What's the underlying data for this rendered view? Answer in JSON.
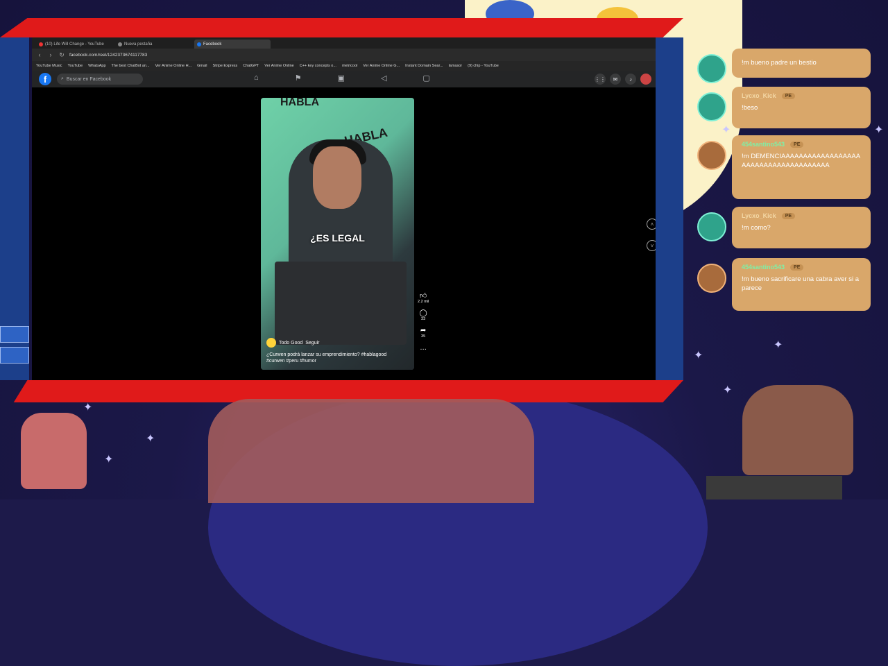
{
  "browser": {
    "tabs": [
      {
        "label": "(10) Life Will Change - YouTube",
        "active": false
      },
      {
        "label": "Nueva pestaña",
        "active": false
      },
      {
        "label": "Facebook",
        "active": true
      }
    ],
    "url": "facebook.com/reel/1242373674117783",
    "bookmarks": [
      "YouTube Music",
      "YouTube",
      "WhatsApp",
      "The best ChatBot an...",
      "Ver Anime Online H...",
      "Gmail",
      "Stripe Express",
      "ChatGPT",
      "Ver Anime Online",
      "C++ key concepts o...",
      "metricool",
      "Ver Anime Online G...",
      "Instant Domain Sear...",
      "lamasor",
      "(9) chip - YouTube"
    ]
  },
  "facebook": {
    "search_placeholder": "Buscar en Facebook",
    "reel": {
      "overlay_caption": "¿ES LEGAL",
      "author": "Todo Good",
      "follow": "Seguir",
      "description": "¿Curwen podrá lanzar su emprendimiento? #hablagood #curwen #peru #humor",
      "likes": "2.2 mil",
      "comments": "33",
      "shares": "35"
    }
  },
  "chat": {
    "messages": [
      {
        "user": "",
        "badge": "",
        "text": "!m bueno padre un bestio"
      },
      {
        "user": "Lycxo_Kick",
        "badge": "PE",
        "text": "!beso"
      },
      {
        "user": "454santino543",
        "badge": "PE",
        "text": "!m DEMENCIAAAAAAAAAAAAAAAAAAAAAAAAAAAAAAAAAAAAAA"
      },
      {
        "user": "Lycxo_Kick",
        "badge": "PE",
        "text": "!m como?"
      },
      {
        "user": "454santino543",
        "badge": "PE",
        "text": "!m bueno sacrificare una cabra aver si aparece"
      }
    ]
  }
}
